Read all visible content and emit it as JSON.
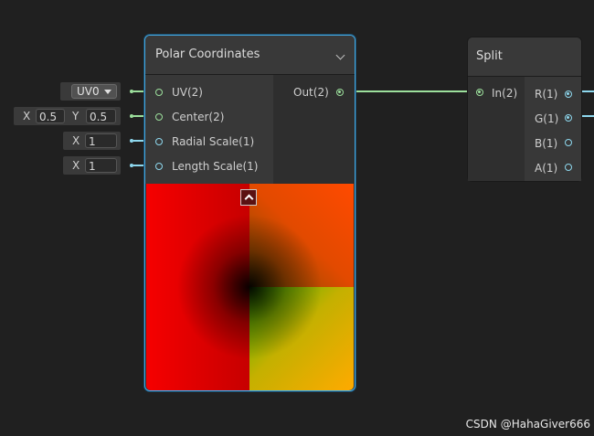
{
  "colors": {
    "vec2": "#9ce09c",
    "vec1": "#8ed8ee",
    "accent": "#44a7e0",
    "background": "#202020"
  },
  "left_fields": {
    "uv": {
      "value": "UV0"
    },
    "center": {
      "x_label": "X",
      "x_value": "0.5",
      "y_label": "Y",
      "y_value": "0.5"
    },
    "radial_scale": {
      "x_label": "X",
      "x_value": "1"
    },
    "length_scale": {
      "x_label": "X",
      "x_value": "1"
    }
  },
  "polar_node": {
    "title": "Polar Coordinates",
    "inputs": [
      {
        "label": "UV(2)",
        "type": "vec2"
      },
      {
        "label": "Center(2)",
        "type": "vec2"
      },
      {
        "label": "Radial Scale(1)",
        "type": "vec1"
      },
      {
        "label": "Length Scale(1)",
        "type": "vec1"
      }
    ],
    "outputs": [
      {
        "label": "Out(2)",
        "type": "vec2"
      }
    ]
  },
  "split_node": {
    "title": "Split",
    "inputs": [
      {
        "label": "In(2)",
        "type": "vec2"
      }
    ],
    "outputs": [
      {
        "label": "R(1)",
        "type": "vec1"
      },
      {
        "label": "G(1)",
        "type": "vec1"
      },
      {
        "label": "B(1)",
        "type": "vec1"
      },
      {
        "label": "A(1)",
        "type": "vec1"
      }
    ]
  },
  "watermark": "CSDN @HahaGiver666"
}
